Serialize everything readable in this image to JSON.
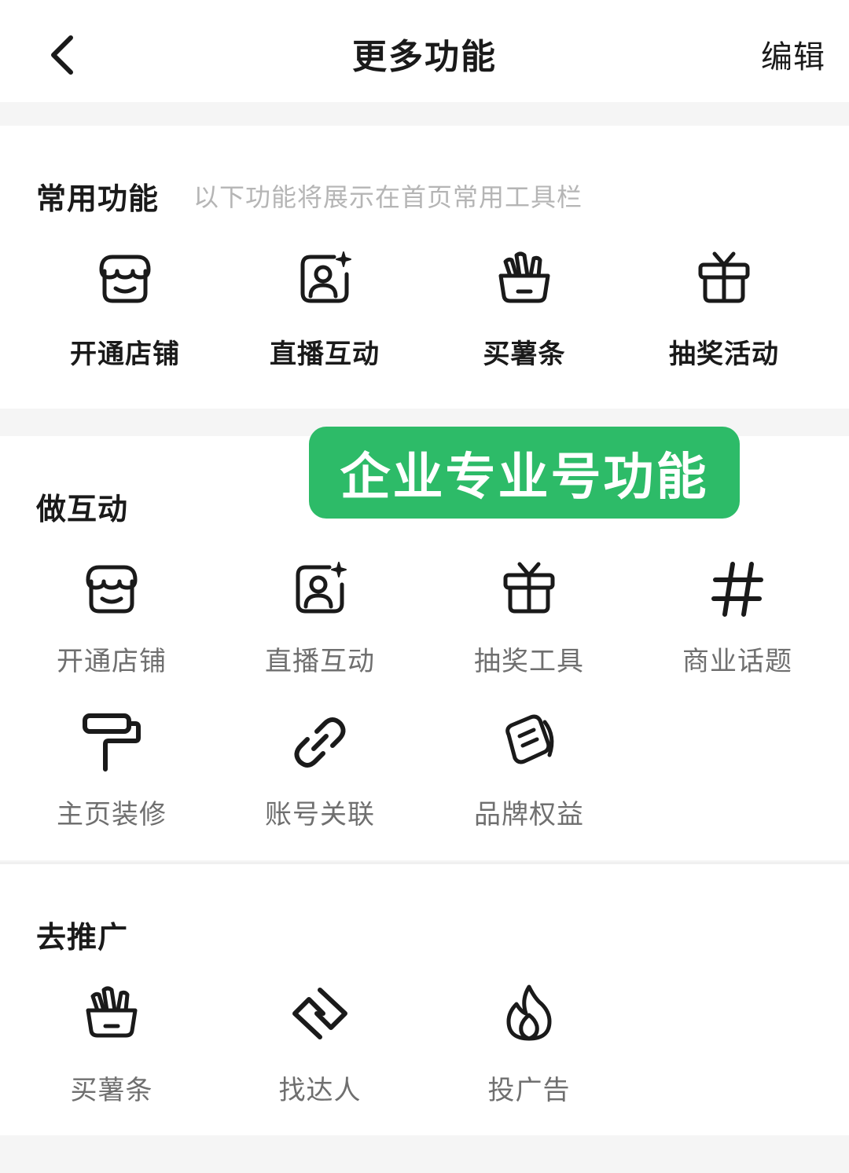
{
  "header": {
    "title": "更多功能",
    "edit_label": "编辑"
  },
  "common_section": {
    "title": "常用功能",
    "subtitle": "以下功能将展示在首页常用工具栏",
    "items": [
      {
        "label": "开通店铺",
        "icon": "store-icon"
      },
      {
        "label": "直播互动",
        "icon": "live-portrait-icon"
      },
      {
        "label": "买薯条",
        "icon": "fries-icon"
      },
      {
        "label": "抽奖活动",
        "icon": "gift-icon"
      }
    ]
  },
  "badge": {
    "text": "企业专业号功能",
    "color": "#2dbb68"
  },
  "interact_section": {
    "title": "做互动",
    "items": [
      {
        "label": "开通店铺",
        "icon": "store-icon"
      },
      {
        "label": "直播互动",
        "icon": "live-portrait-icon"
      },
      {
        "label": "抽奖工具",
        "icon": "gift-icon"
      },
      {
        "label": "商业话题",
        "icon": "hashtag-icon"
      },
      {
        "label": "主页装修",
        "icon": "paint-roller-icon"
      },
      {
        "label": "账号关联",
        "icon": "link-icon"
      },
      {
        "label": "品牌权益",
        "icon": "coupon-icon"
      }
    ]
  },
  "promote_section": {
    "title": "去推广",
    "items": [
      {
        "label": "买薯条",
        "icon": "fries-icon"
      },
      {
        "label": "找达人",
        "icon": "handshake-icon"
      },
      {
        "label": "投广告",
        "icon": "flame-icon"
      }
    ]
  }
}
